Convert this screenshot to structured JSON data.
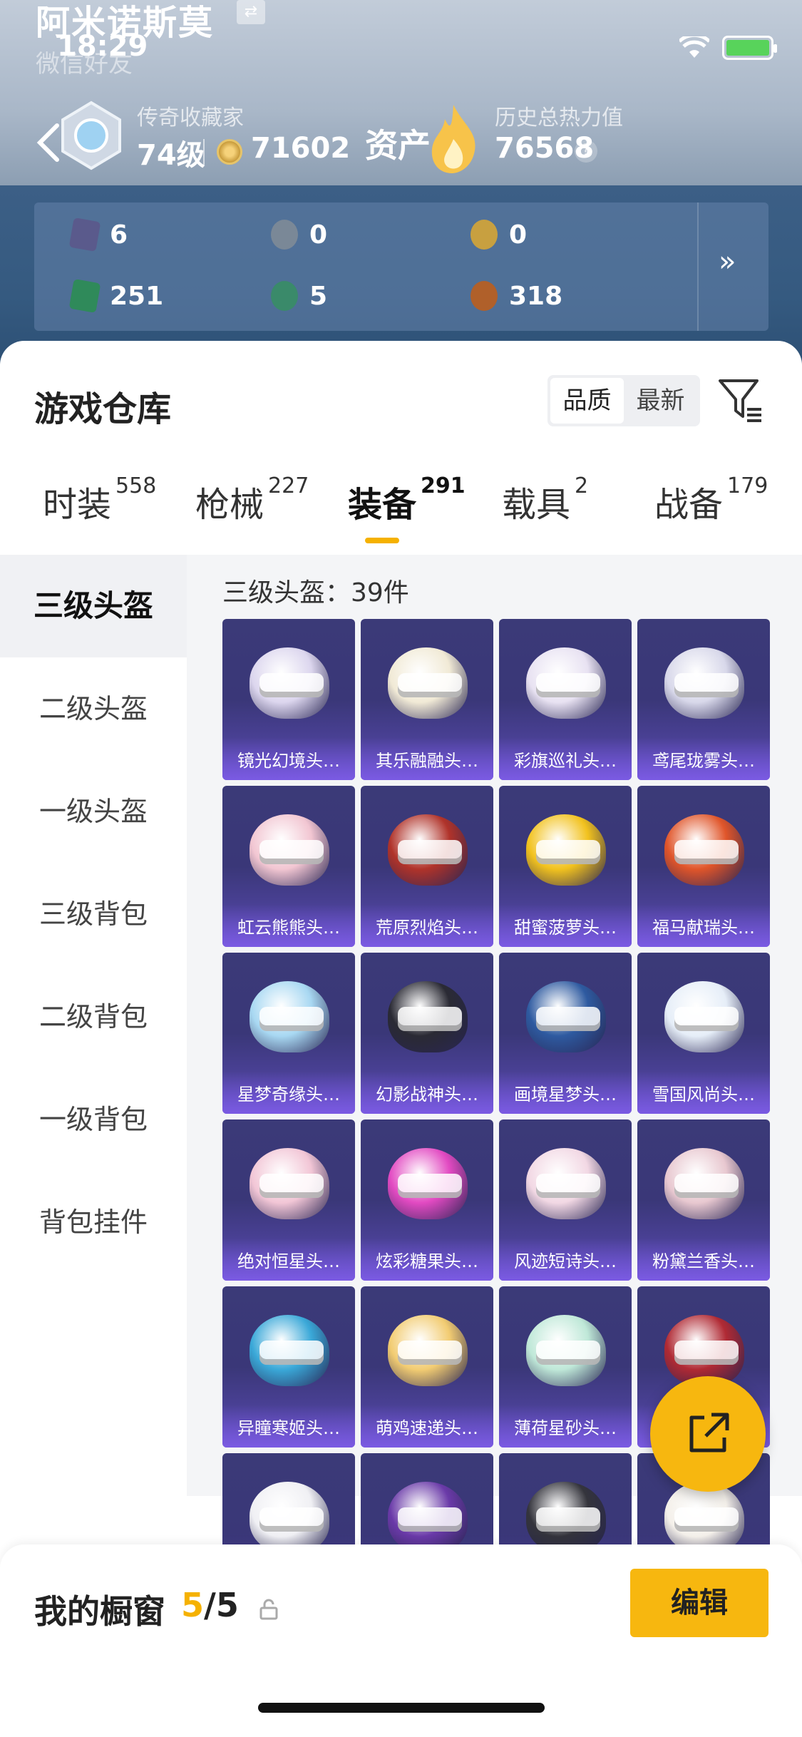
{
  "status_bar": {
    "time": "18:29"
  },
  "header": {
    "nickname": "阿米诺斯莫",
    "subtitle": "微信好友",
    "subtitle_extra": "",
    "rank_title": "传奇收藏家",
    "level": "74级",
    "coins": "71602",
    "assets_label": "资产",
    "heat_title": "历史总热力值",
    "heat_value": "76568",
    "help": "?"
  },
  "resources": [
    {
      "icon": "purple-card-icon",
      "value": "6",
      "color": "#5a5a8c"
    },
    {
      "icon": "silver-token-icon",
      "value": "0",
      "color": "#7a8897"
    },
    {
      "icon": "gold-token-icon",
      "value": "0",
      "color": "#c8a040"
    },
    {
      "icon": "green-card-icon",
      "value": "251",
      "color": "#2f8a5a"
    },
    {
      "icon": "green-orb-icon",
      "value": "5",
      "color": "#3a8a6a"
    },
    {
      "icon": "bronze-coin-icon",
      "value": "318",
      "color": "#b0602a"
    }
  ],
  "resources_more": "»",
  "warehouse": {
    "title": "游戏仓库",
    "sort_options": [
      "品质",
      "最新"
    ],
    "sort_active": "品质"
  },
  "tabs": [
    {
      "label": "时装",
      "count": "558"
    },
    {
      "label": "枪械",
      "count": "227"
    },
    {
      "label": "装备",
      "count": "291"
    },
    {
      "label": "载具",
      "count": "2"
    },
    {
      "label": "战备",
      "count": "179"
    }
  ],
  "sidebar": [
    "三级头盔",
    "二级头盔",
    "一级头盔",
    "三级背包",
    "二级背包",
    "一级背包",
    "背包挂件"
  ],
  "grid_header": "三级头盔：39件",
  "items": [
    {
      "name": "镜光幻境头…",
      "color": "#dcd6ee"
    },
    {
      "name": "其乐融融头…",
      "color": "#f1ead6"
    },
    {
      "name": "彩旗巡礼头…",
      "color": "#e8e2f2"
    },
    {
      "name": "鸢尾珑雾头…",
      "color": "#d8d8ea"
    },
    {
      "name": "虹云熊熊头…",
      "color": "#f2c6d2"
    },
    {
      "name": "荒原烈焰头…",
      "color": "#b0332a"
    },
    {
      "name": "甜蜜菠萝头…",
      "color": "#f2c21e"
    },
    {
      "name": "福马献瑞头…",
      "color": "#e0552a"
    },
    {
      "name": "星梦奇缘头…",
      "color": "#a8d8f2"
    },
    {
      "name": "幻影战神头…",
      "color": "#2a2a34"
    },
    {
      "name": "画境星梦头…",
      "color": "#2e5aa0"
    },
    {
      "name": "雪国风尚头…",
      "color": "#e6eef8"
    },
    {
      "name": "绝对恒星头…",
      "color": "#f2c6d6"
    },
    {
      "name": "炫彩糖果头…",
      "color": "#e24ac2"
    },
    {
      "name": "风迹短诗头…",
      "color": "#f2d8e4"
    },
    {
      "name": "粉黛兰香头…",
      "color": "#e8c8d0"
    },
    {
      "name": "异瞳寒姬头…",
      "color": "#3aa8d8"
    },
    {
      "name": "萌鸡速递头…",
      "color": "#f2cc72"
    },
    {
      "name": "薄荷星砂头…",
      "color": "#bfe8d8"
    },
    {
      "name": "",
      "color": "#b02a34"
    },
    {
      "name": "",
      "color": "#f0f0f4"
    },
    {
      "name": "",
      "color": "#6a3aa8"
    },
    {
      "name": "",
      "color": "#34343c"
    },
    {
      "name": "",
      "color": "#f4f0ea"
    }
  ],
  "showcase": {
    "label": "我的橱窗",
    "current": "5",
    "total": "/5",
    "edit": "编辑"
  }
}
